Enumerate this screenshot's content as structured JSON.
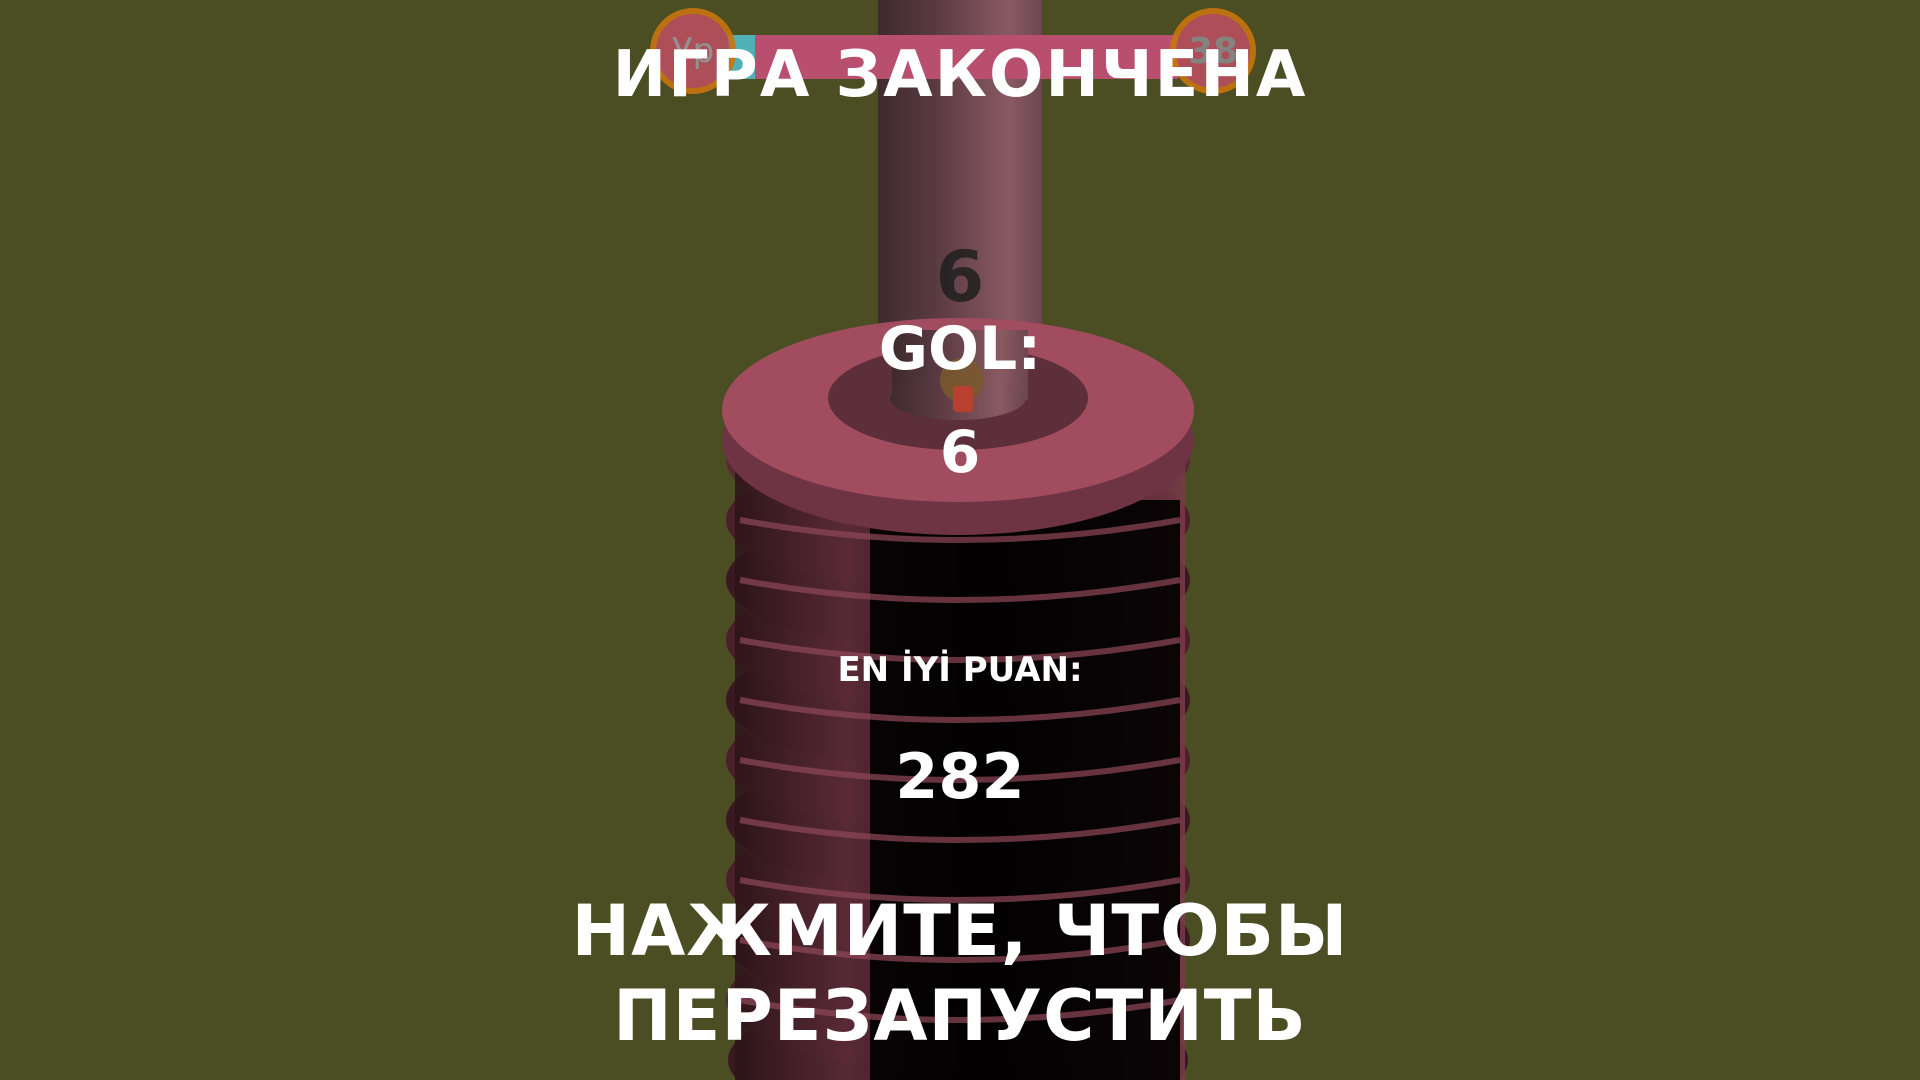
{
  "hud": {
    "current_level": "Ур",
    "next_level": "38",
    "progress_fraction": 0.06
  },
  "game_over": {
    "title": "ИГРА ЗАКОНЧЕНА",
    "ball_score": "6",
    "score_label": "GOL:",
    "score_value": "6",
    "best_label": "EN İYİ PUAN:",
    "best_value": "282",
    "restart_line1": "НАЖМИТЕ, ЧТОБЫ",
    "restart_line2": "ПЕРЕЗАПУСТИТЬ"
  },
  "colors": {
    "background": "#4b4e23",
    "tower": "#9b4a5e",
    "pole": "#7a4c55",
    "ball": "#b8402e",
    "progress_fill": "#4fb1b7",
    "progress_track": "#b94f6e"
  }
}
